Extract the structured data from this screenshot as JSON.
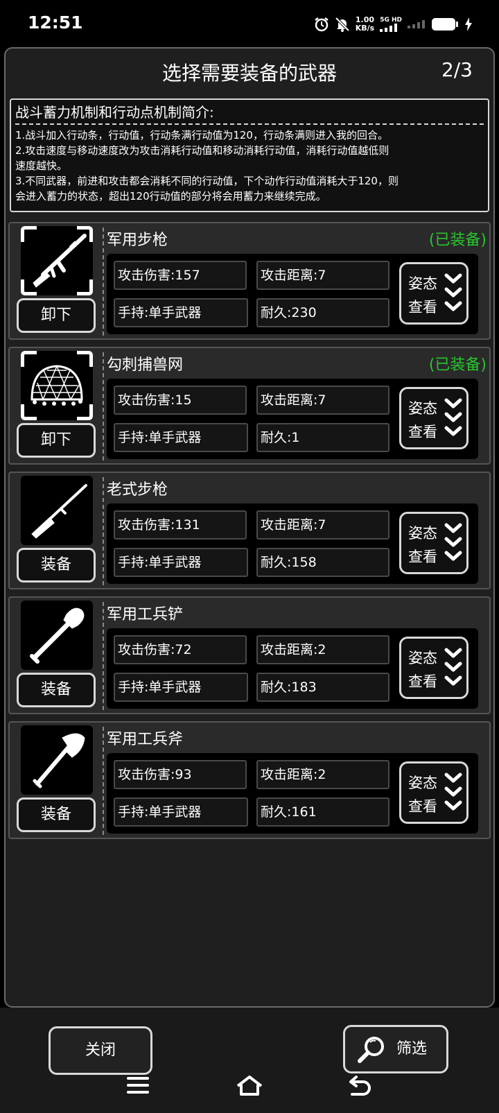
{
  "status_bar": {
    "time": "12:51",
    "net_speed_value": "1.00",
    "net_speed_unit": "KB/s",
    "network_label": "5G HD",
    "icons": [
      "alarm-icon",
      "mute-icon",
      "signal-icon",
      "battery-icon",
      "charging-icon"
    ]
  },
  "header": {
    "title": "选择需要装备的武器",
    "page": "2/3"
  },
  "intro": {
    "title": "战斗蓄力机制和行动点机制简介:",
    "lines": [
      "1.战斗加入行动条，行动值，行动条满行动值为120，行动条满则进入我的回合。",
      "2.攻击速度与移动速度改为攻击消耗行动值和移动消耗行动值，消耗行动值越低则",
      "速度越快。",
      "3.不同武器，前进和攻击都会消耗不同的行动值，下个动作行动值消耗大于120，则",
      "会进入蓄力的状态，超出120行动值的部分将会用蓄力来继续完成。"
    ]
  },
  "weapons": [
    {
      "name": "军用步枪",
      "status": "(已装备)",
      "action": "卸下",
      "damage": "攻击伤害:157",
      "range": "攻击距离:7",
      "hold": "手持:单手武器",
      "durability": "耐久:230",
      "icon": "rifle-icon"
    },
    {
      "name": "勾刺捕兽网",
      "status": "(已装备)",
      "action": "卸下",
      "damage": "攻击伤害:15",
      "range": "攻击距离:7",
      "hold": "手持:单手武器",
      "durability": "耐久:1",
      "icon": "net-icon"
    },
    {
      "name": "老式步枪",
      "status": "",
      "action": "装备",
      "damage": "攻击伤害:131",
      "range": "攻击距离:7",
      "hold": "手持:单手武器",
      "durability": "耐久:158",
      "icon": "old-rifle-icon"
    },
    {
      "name": "军用工兵铲",
      "status": "",
      "action": "装备",
      "damage": "攻击伤害:72",
      "range": "攻击距离:2",
      "hold": "手持:单手武器",
      "durability": "耐久:183",
      "icon": "shovel-icon"
    },
    {
      "name": "军用工兵斧",
      "status": "",
      "action": "装备",
      "damage": "攻击伤害:93",
      "range": "攻击距离:2",
      "hold": "手持:单手武器",
      "durability": "耐久:161",
      "icon": "axe-icon"
    }
  ],
  "pose_button": {
    "line1": "姿态",
    "line2": "查看"
  },
  "bottom": {
    "close": "关闭",
    "filter": "筛选"
  },
  "colors": {
    "equipped": "#29c42e",
    "background": "#000000",
    "panel": "#1f1f1f"
  }
}
